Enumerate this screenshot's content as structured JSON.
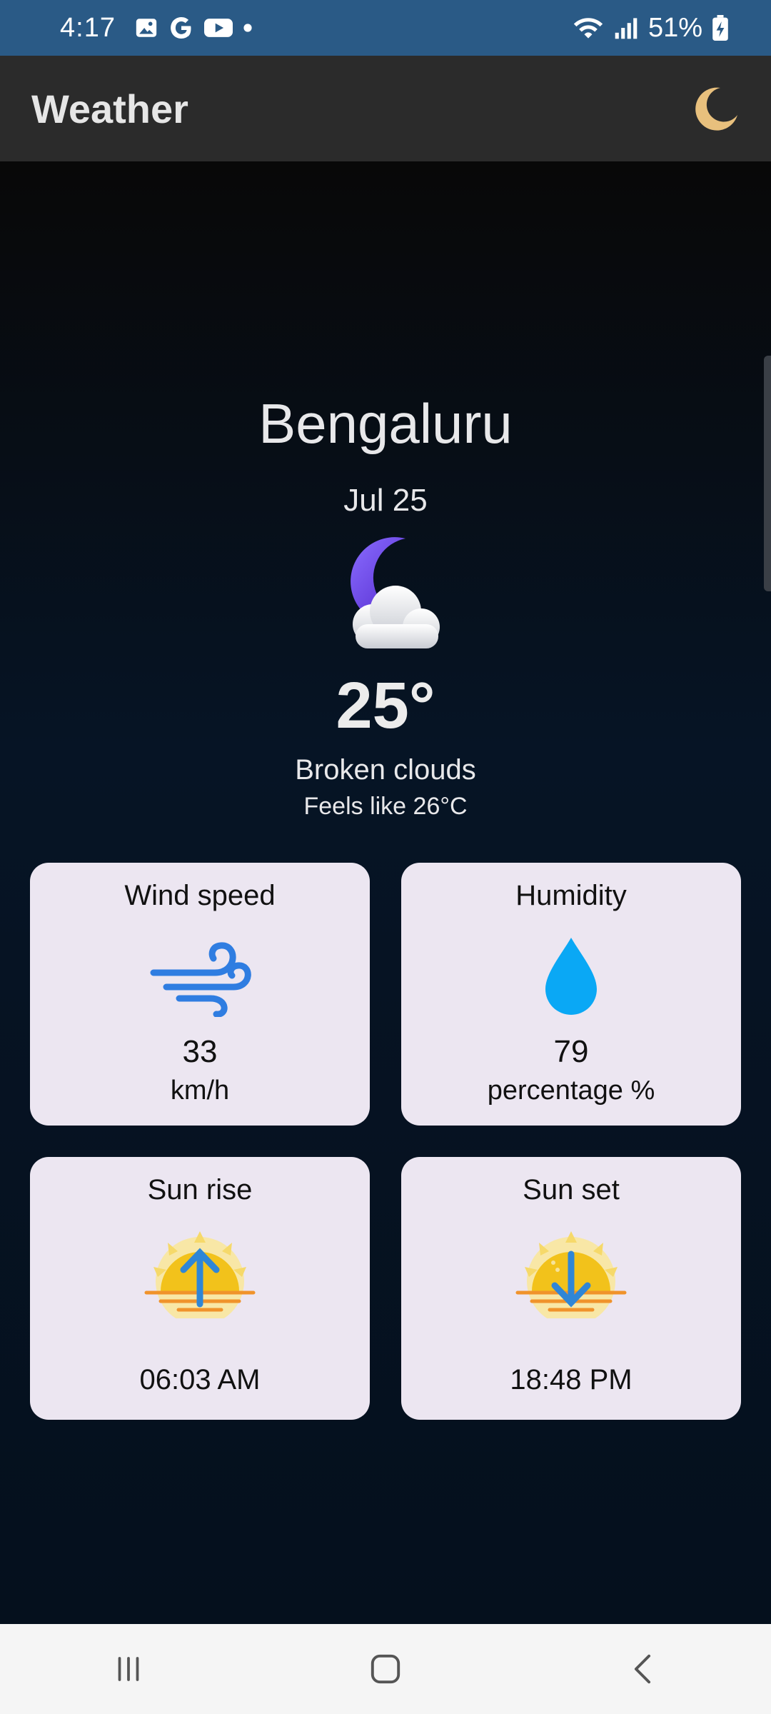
{
  "status_bar": {
    "time": "4:17",
    "battery": "51%",
    "icons": [
      "gallery-icon",
      "google-icon",
      "youtube-icon",
      "dot-icon",
      "wifi-icon",
      "signal-icon",
      "battery-icon"
    ]
  },
  "app_bar": {
    "title": "Weather",
    "theme_icon": "moon-icon",
    "theme_icon_color": "#e8c07d"
  },
  "weather": {
    "city": "Bengaluru",
    "date": "Jul 25",
    "icon": "moon-cloud-icon",
    "temperature": "25°",
    "condition": "Broken clouds",
    "feels_like": "Feels like 26°C"
  },
  "cards": {
    "wind": {
      "title": "Wind speed",
      "icon": "wind-icon",
      "value": "33",
      "unit": "km/h"
    },
    "humidity": {
      "title": "Humidity",
      "icon": "water-drop-icon",
      "value": "79",
      "unit": "percentage %"
    },
    "sunrise": {
      "title": "Sun rise",
      "icon": "sunrise-icon",
      "time": "06:03 AM"
    },
    "sunset": {
      "title": "Sun set",
      "icon": "sunset-icon",
      "time": "18:48 PM"
    }
  },
  "colors": {
    "status_bar": "#2a5a86",
    "app_bar": "#2b2b2b",
    "card_bg": "#ece6f1",
    "wind_icon": "#2f7de1",
    "drop_icon": "#0aa8f5",
    "sun": "#f2c21b"
  },
  "nav_bar": {
    "items": [
      "recent-apps-icon",
      "home-icon",
      "back-icon"
    ]
  }
}
